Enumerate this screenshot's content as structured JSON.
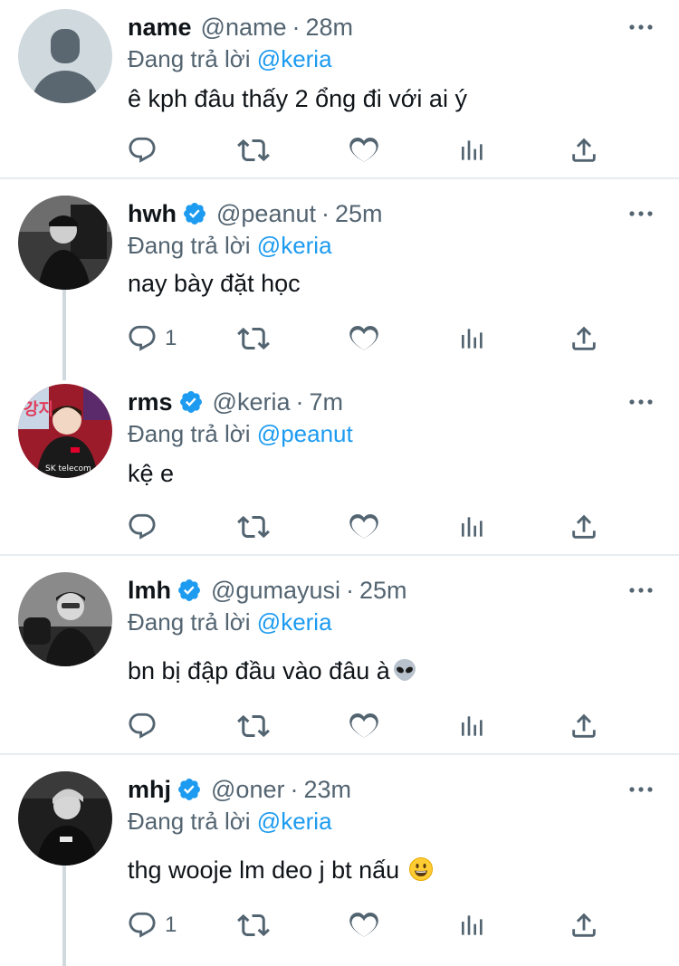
{
  "colors": {
    "accent": "#1d9bf0",
    "muted": "#536471",
    "text": "#0f1419",
    "divider": "#e6ecf0"
  },
  "icons": [
    "more-icon",
    "verified-icon",
    "reply-icon",
    "retweet-icon",
    "like-icon",
    "views-icon",
    "share-icon",
    "alien-emoji",
    "smiley-emoji"
  ],
  "tweets": [
    {
      "name": "name",
      "handle": "@name",
      "dot": "·",
      "time": "28m",
      "replying_prefix": "Đang trả lời",
      "replying_to": "@keria",
      "text": "ê kph đâu thấy 2 ổng đi với ai ý",
      "reply_count": ""
    },
    {
      "name": "hwh",
      "handle": "@peanut",
      "dot": "·",
      "time": "25m",
      "replying_prefix": "Đang trả lời",
      "replying_to": "@keria",
      "text": "nay bày đặt học",
      "reply_count": "1"
    },
    {
      "name": "rms",
      "handle": "@keria",
      "dot": "·",
      "time": "7m",
      "replying_prefix": "Đang trả lời",
      "replying_to": "@peanut",
      "text": "kệ e",
      "reply_count": ""
    },
    {
      "name": "lmh",
      "handle": "@gumayusi",
      "dot": "·",
      "time": "25m",
      "replying_prefix": "Đang trả lời",
      "replying_to": "@keria",
      "text": "bn bị đập đầu vào đâu à",
      "reply_count": ""
    },
    {
      "name": "mhj",
      "handle": "@oner",
      "dot": "·",
      "time": "23m",
      "replying_prefix": "Đang trả lời",
      "replying_to": "@keria",
      "text": "thg wooje lm deo j bt nấu ",
      "reply_count": "1"
    }
  ]
}
